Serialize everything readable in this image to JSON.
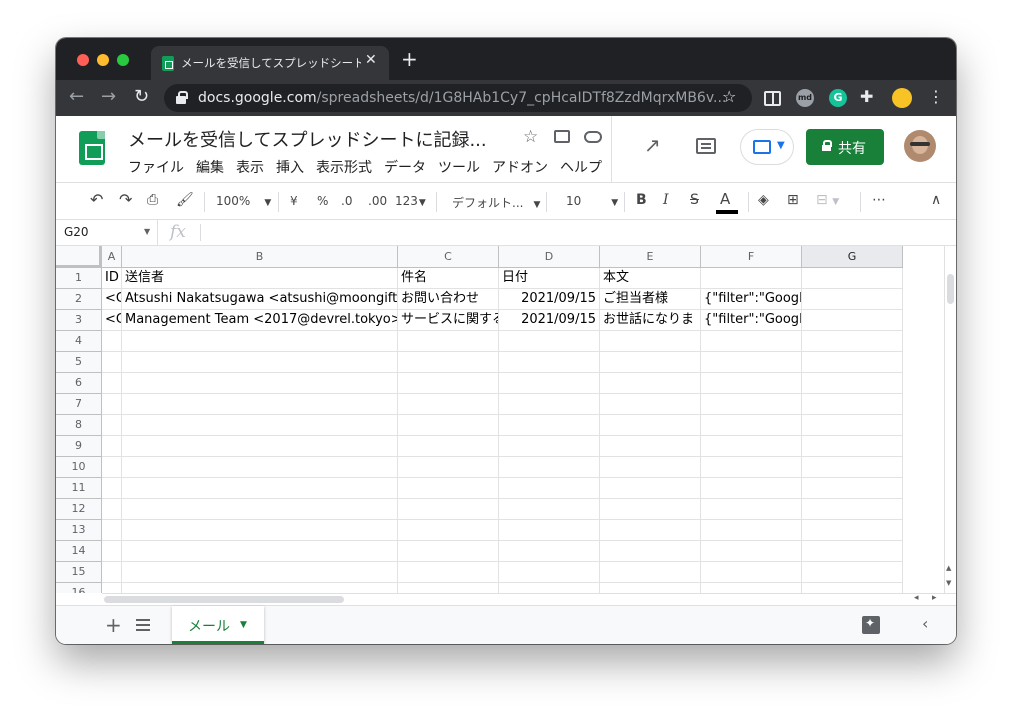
{
  "browser": {
    "tab_title": "メールを受信してスプレッドシート",
    "url_host": "docs.google.com",
    "url_path": "/spreadsheets/d/1G8HAb1Cy7_cpHcaIDTf8ZzdMqrxMB6v..."
  },
  "doc": {
    "title": "メールを受信してスプレッドシートに記録...",
    "menus": [
      "ファイル",
      "編集",
      "表示",
      "挿入",
      "表示形式",
      "データ",
      "ツール",
      "アドオン",
      "ヘルプ"
    ],
    "share_label": "共有"
  },
  "toolbar": {
    "zoom": "100%",
    "currency": "¥",
    "percent": "%",
    "decimal_less": ".0",
    "decimal_more": ".00",
    "number_format": "123",
    "font": "デフォルト...",
    "font_size": "10",
    "bold": "B",
    "italic": "I",
    "strike": "S",
    "text_color": "A"
  },
  "formula_bar": {
    "name_box": "G20",
    "fx": "fx"
  },
  "grid": {
    "columns": [
      "A",
      "B",
      "C",
      "D",
      "E",
      "F",
      "G"
    ],
    "rows": [
      [
        "ID",
        "送信者",
        "件名",
        "日付",
        "本文",
        "",
        ""
      ],
      [
        "<C",
        "Atsushi Nakatsugawa <atsushi@moongift.jp>",
        "お問い合わせ",
        "2021/09/15",
        "ご担当者様",
        "{\"filter\":\"Googleシート記録用\",\"headers\":",
        ""
      ],
      [
        "<C",
        "Management Team <2017@devrel.tokyo>",
        "サービスに関する",
        "2021/09/15",
        "お世話になりま",
        "{\"filter\":\"Googleシート記録用\",\"headers\":",
        ""
      ],
      [
        "",
        "",
        "",
        "",
        "",
        "",
        ""
      ],
      [
        "",
        "",
        "",
        "",
        "",
        "",
        ""
      ],
      [
        "",
        "",
        "",
        "",
        "",
        "",
        ""
      ],
      [
        "",
        "",
        "",
        "",
        "",
        "",
        ""
      ],
      [
        "",
        "",
        "",
        "",
        "",
        "",
        ""
      ],
      [
        "",
        "",
        "",
        "",
        "",
        "",
        ""
      ],
      [
        "",
        "",
        "",
        "",
        "",
        "",
        ""
      ],
      [
        "",
        "",
        "",
        "",
        "",
        "",
        ""
      ],
      [
        "",
        "",
        "",
        "",
        "",
        "",
        ""
      ],
      [
        "",
        "",
        "",
        "",
        "",
        "",
        ""
      ],
      [
        "",
        "",
        "",
        "",
        "",
        "",
        ""
      ],
      [
        "",
        "",
        "",
        "",
        "",
        "",
        ""
      ],
      [
        "",
        "",
        "",
        "",
        "",
        "",
        ""
      ]
    ],
    "row_numbers": [
      "1",
      "2",
      "3",
      "4",
      "5",
      "6",
      "7",
      "8",
      "9",
      "10",
      "11",
      "12",
      "13",
      "14",
      "15",
      "16"
    ],
    "selected_column": "G"
  },
  "sheets": {
    "active_tab": "メール"
  }
}
